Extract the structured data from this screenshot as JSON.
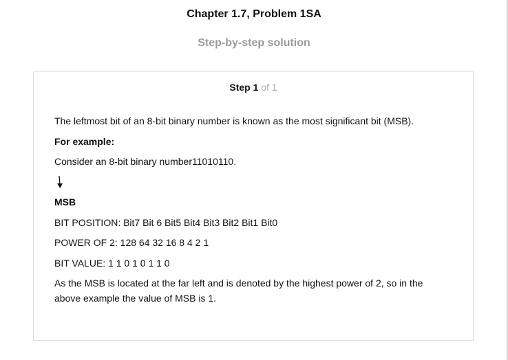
{
  "header": {
    "chapter_title": "Chapter 1.7, Problem 1SA",
    "subtitle": "Step-by-step solution"
  },
  "step": {
    "label": "Step",
    "number": "1",
    "of_text": "of 1"
  },
  "solution": {
    "intro": "The leftmost bit of an 8-bit binary number is known as the most significant bit (MSB).",
    "example_heading": "For example:",
    "consider": "Consider an 8-bit binary number11010110.",
    "arrow_icon": "down-arrow-icon",
    "msb_label": "MSB",
    "bit_position": "BIT POSITION: Bit7 Bit 6 Bit5 Bit4 Bit3 Bit2 Bit1 Bit0",
    "power_of_2": "POWER OF 2: 128 64 32 16 8 4 2 1",
    "bit_value": "BIT VALUE: 1 1 0 1 0 1 1 0",
    "conclusion": "As the MSB is located at the far left and is denoted by the highest power of 2, so in the above example the value of MSB is 1."
  }
}
